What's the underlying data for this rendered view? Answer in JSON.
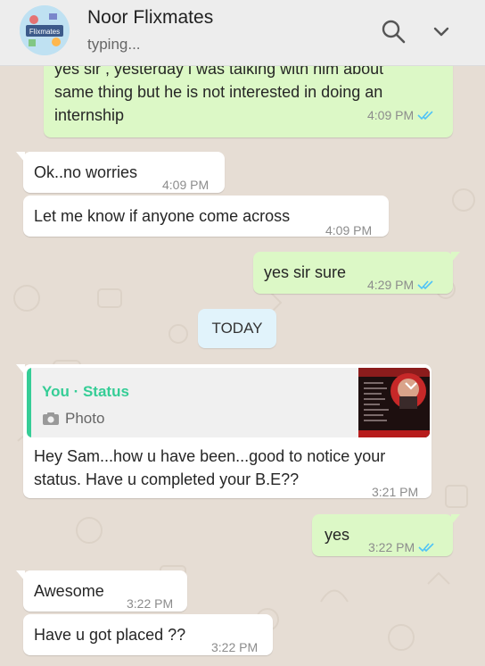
{
  "header": {
    "contact_name": "Noor Flixmates",
    "status": "typing...",
    "avatar_logo_text": "Flixmates"
  },
  "messages": [
    {
      "id": "m1",
      "direction": "out",
      "lines": [
        "yes sir , yesterday i was talking with him about",
        "same thing but he is not interested in doing an",
        "internship"
      ],
      "time": "4:09 PM",
      "read": true
    },
    {
      "id": "m2",
      "direction": "in",
      "text": "Ok..no worries",
      "time": "4:09 PM"
    },
    {
      "id": "m3",
      "direction": "in",
      "text": "Let me know if anyone come across",
      "time": "4:09 PM"
    },
    {
      "id": "m4",
      "direction": "out",
      "text": "yes sir sure",
      "time": "4:29 PM",
      "read": true
    },
    {
      "id": "m5",
      "direction": "in",
      "quote": {
        "title": "You · Status",
        "subtitle": "Photo"
      },
      "lines": [
        "Hey Sam...how u have been...good to notice your",
        "status. Have u completed your B.E??"
      ],
      "time": "3:21 PM"
    },
    {
      "id": "m6",
      "direction": "out",
      "text": "yes",
      "time": "3:22 PM",
      "read": true
    },
    {
      "id": "m7",
      "direction": "in",
      "text": "Awesome",
      "time": "3:22 PM"
    },
    {
      "id": "m8",
      "direction": "in",
      "text": "Have u got placed ??",
      "time": "3:22 PM"
    }
  ],
  "day_divider": "TODAY",
  "icons": {
    "search": "search-icon",
    "menu": "chevron-down-icon",
    "read_receipt": "double-check-icon",
    "camera": "camera-icon"
  },
  "colors": {
    "outgoing_bubble": "#dcf8c6",
    "incoming_bubble": "#ffffff",
    "read_tick": "#4fc3f7",
    "status_accent": "#35cd96",
    "day_chip": "#e1f3fb",
    "chat_background": "#e6ddd4"
  }
}
